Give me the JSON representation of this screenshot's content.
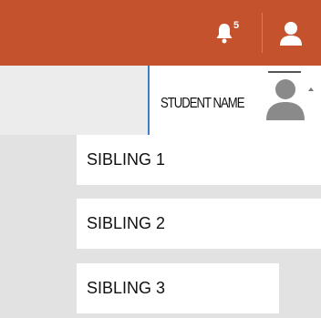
{
  "header": {
    "background": "#c4532d",
    "notifications": {
      "icon": "bell-icon",
      "count": "5"
    },
    "user_icon": "user-icon"
  },
  "student": {
    "name": "STUDENT NAME",
    "avatar_icon": "avatar-icon",
    "accent": "#3f7ec7"
  },
  "siblings": [
    {
      "label": "SIBLING 1"
    },
    {
      "label": "SIBLING 2"
    },
    {
      "label": "SIBLING 3"
    }
  ]
}
